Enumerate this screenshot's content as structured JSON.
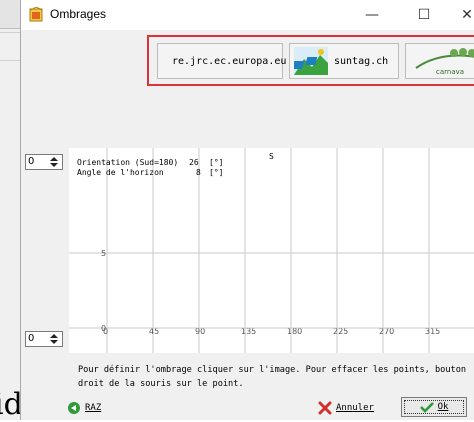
{
  "window": {
    "title": "Ombrages",
    "controls": {
      "minimize": "—",
      "maximize": "☐",
      "close": "✕"
    }
  },
  "links": {
    "jrc_label": "re.jrc.ec.europa.eu",
    "suntag_label": "suntag.ch",
    "carnaval_label": "carnava"
  },
  "spinners": {
    "top_value": "0",
    "bottom_value": "0"
  },
  "chart": {
    "orientation_label": "Orientation (Sud=180)",
    "orientation_value": "26",
    "horizon_label": "Angle de l'horizon",
    "horizon_value": "8",
    "unit": "[°]",
    "south_marker": "S"
  },
  "chart_data": {
    "type": "line",
    "x_ticks": [
      "0",
      "45",
      "90",
      "135",
      "180",
      "225",
      "270",
      "315"
    ],
    "y_ticks": [
      "5",
      "0"
    ],
    "xlim": [
      0,
      360
    ],
    "ylim": [
      0,
      10
    ],
    "grid": true,
    "series": []
  },
  "hint": {
    "text": "Pour définir l'ombrage cliquer sur l'image. Pour effacer les points, bouton droit de la souris sur le point."
  },
  "buttons": {
    "raz": "RAZ",
    "annuler": "Annuler",
    "ok": "Ok"
  },
  "background": {
    "partial_text": "id"
  },
  "colors": {
    "highlight_border": "#d9323a",
    "grid": "#c8c8c8",
    "dialog_bg": "#f0f0f0"
  }
}
